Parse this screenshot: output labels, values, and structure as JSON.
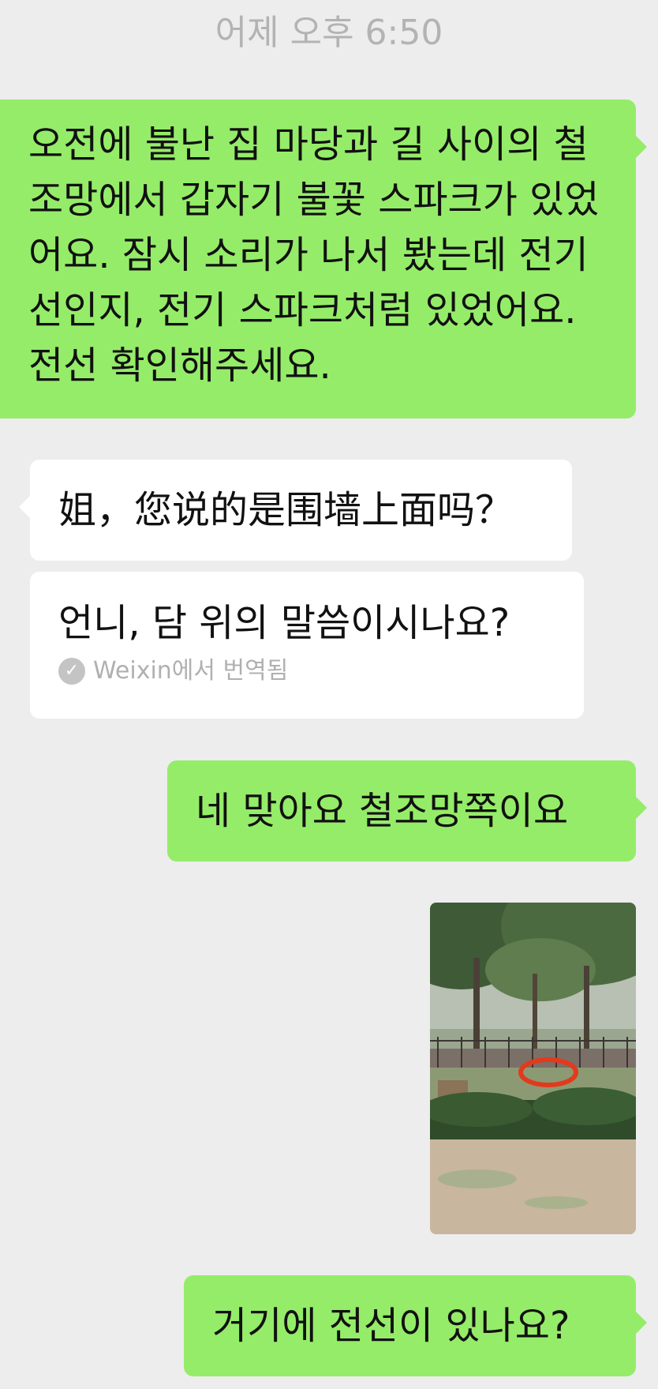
{
  "timestamp": "어제 오후 6:50",
  "messages": [
    {
      "sender": "me",
      "text": "오전에 불난 집 마당과 길 사이의 철조망에서 갑자기 불꽃 스파크가 있었어요. 잠시 소리가 나서 봤는데 전기선인지, 전기 스파크처럼 있었어요. 전선 확인해주세요."
    },
    {
      "sender": "them",
      "text": "姐，您说的是围墙上面吗？"
    },
    {
      "sender": "them",
      "text": "언니, 담 위의 말씀이시나요?",
      "translation_note": "Weixin에서 번역됨"
    },
    {
      "sender": "me",
      "text": "네 맞아요 철조망쪽이요"
    },
    {
      "sender": "me",
      "type": "image",
      "icon": "photo-thumbnail"
    },
    {
      "sender": "me",
      "text": "거기에 전선이 있나요?"
    }
  ],
  "colors": {
    "background": "#ededed",
    "my_bubble": "#95ec69",
    "their_bubble": "#ffffff",
    "timestamp": "#b3b3b3",
    "translation_note": "#b0b0b0"
  }
}
